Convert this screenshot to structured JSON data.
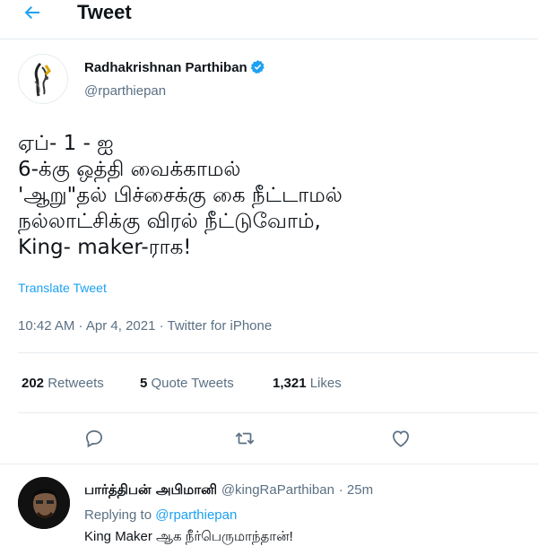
{
  "header": {
    "back_icon": "arrow-left-icon",
    "title": "Tweet"
  },
  "tweet": {
    "author_name": "Radhakrishnan Parthiban",
    "handle": "@rparthiepan",
    "lines": [
      "ஏப்- 1 - ஐ",
      "6-க்கு ஒத்தி வைக்காமல்",
      "'ஆறு\"தல் பிச்சைக்கு கை நீட்டாமல்",
      "நல்லாட்சிக்கு விரல் நீட்டுவோம்,",
      "King- maker-ராக!"
    ],
    "translate": "Translate Tweet",
    "meta": "10:42 AM · Apr 4, 2021 · Twitter for iPhone"
  },
  "stats": {
    "retweets_count": "202",
    "retweets_label": "Retweets",
    "quotes_count": "5",
    "quotes_label": "Quote Tweets",
    "likes_count": "1,321",
    "likes_label": "Likes"
  },
  "actions": [
    "reply-icon",
    "retweet-icon",
    "like-icon"
  ],
  "reply": {
    "name": "பார்த்திபன் அபிமானி",
    "handle": "@kingRaParthiban",
    "time": "· 25m",
    "replying_prefix": "Replying to",
    "replying_handle": "@rparthiepan",
    "text": "King Maker ஆக நீர்பெருமாந்தான்!"
  },
  "colors": {
    "accent": "#1da1f2",
    "secondary_text": "#5b7083",
    "border": "#e6ecf0"
  }
}
